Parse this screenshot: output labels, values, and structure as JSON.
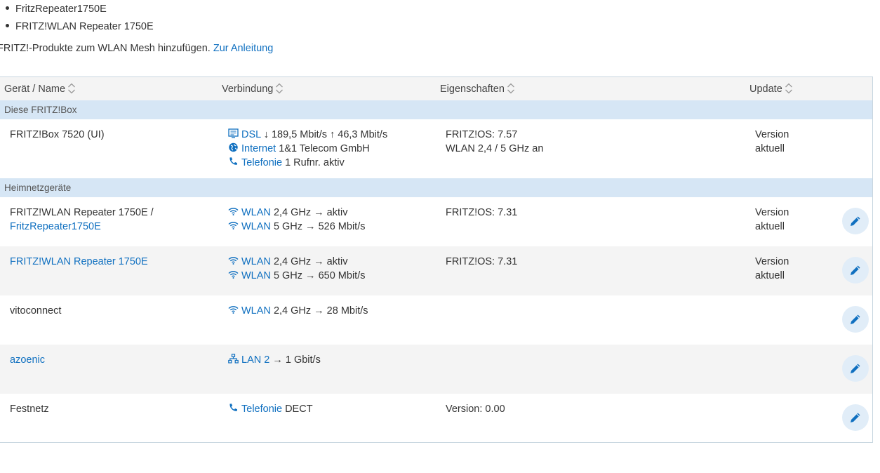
{
  "bullets": [
    "FritzRepeater1750E",
    "FRITZ!WLAN Repeater 1750E"
  ],
  "intro": {
    "text": "FRITZ!-Produkte zum WLAN Mesh hinzufügen.",
    "link": "Zur Anleitung"
  },
  "table": {
    "columns": [
      "Gerät / Name",
      "Verbindung",
      "Eigenschaften",
      "Update"
    ],
    "groups": {
      "fritzbox": "Diese FRITZ!Box",
      "home": "Heimnetzgeräte"
    },
    "fritzbox": {
      "name": "FRITZ!Box 7520 (UI)",
      "dsl": {
        "link": "DSL",
        "text": "↓ 189,5 Mbit/s ↑ 46,3 Mbit/s"
      },
      "internet": {
        "link": "Internet",
        "text": "1&1 Telecom GmbH"
      },
      "telefonie": {
        "link": "Telefonie",
        "text": "1 Rufnr. aktiv"
      },
      "props": [
        "FRITZ!OS: 7.57",
        "WLAN 2,4 / 5 GHz an"
      ],
      "update": [
        "Version",
        "aktuell"
      ]
    },
    "devices": [
      {
        "name": "FRITZ!WLAN Repeater 1750E /",
        "name_link": "FritzRepeater1750E",
        "conn": [
          {
            "icon": "wifi-icon",
            "link": "WLAN",
            "text": "2,4 GHz → aktiv"
          },
          {
            "icon": "wifi-icon",
            "link": "WLAN",
            "text": "5 GHz → 526 Mbit/s"
          }
        ],
        "props": "FRITZ!OS: 7.31",
        "update": [
          "Version",
          "aktuell"
        ]
      },
      {
        "name": "",
        "name_link": "FRITZ!WLAN Repeater 1750E",
        "conn": [
          {
            "icon": "wifi-icon",
            "link": "WLAN",
            "text": "2,4 GHz → aktiv"
          },
          {
            "icon": "wifi-icon",
            "link": "WLAN",
            "text": "5 GHz → 650 Mbit/s"
          }
        ],
        "props": "FRITZ!OS: 7.31",
        "update": [
          "Version",
          "aktuell"
        ]
      },
      {
        "name": "vitoconnect",
        "name_link": "",
        "conn": [
          {
            "icon": "wifi-icon",
            "link": "WLAN",
            "text": "2,4 GHz → 28 Mbit/s"
          }
        ],
        "props": "",
        "update": [
          "",
          ""
        ]
      },
      {
        "name": "",
        "name_link": "azoenic",
        "conn": [
          {
            "icon": "lan-icon",
            "link": "LAN 2",
            "text": "→ 1 Gbit/s"
          }
        ],
        "props": "",
        "update": [
          "",
          ""
        ]
      },
      {
        "name": "Festnetz",
        "name_link": "",
        "conn": [
          {
            "icon": "phone-icon",
            "link": "Telefonie",
            "text": "DECT"
          }
        ],
        "props": "Version: 0.00",
        "update": [
          "",
          ""
        ]
      }
    ]
  },
  "colors": {
    "link": "#1070c0",
    "group_bg": "#d6e6f5",
    "alt_row": "#f4f4f4",
    "edit_bg": "#e1edf8"
  }
}
